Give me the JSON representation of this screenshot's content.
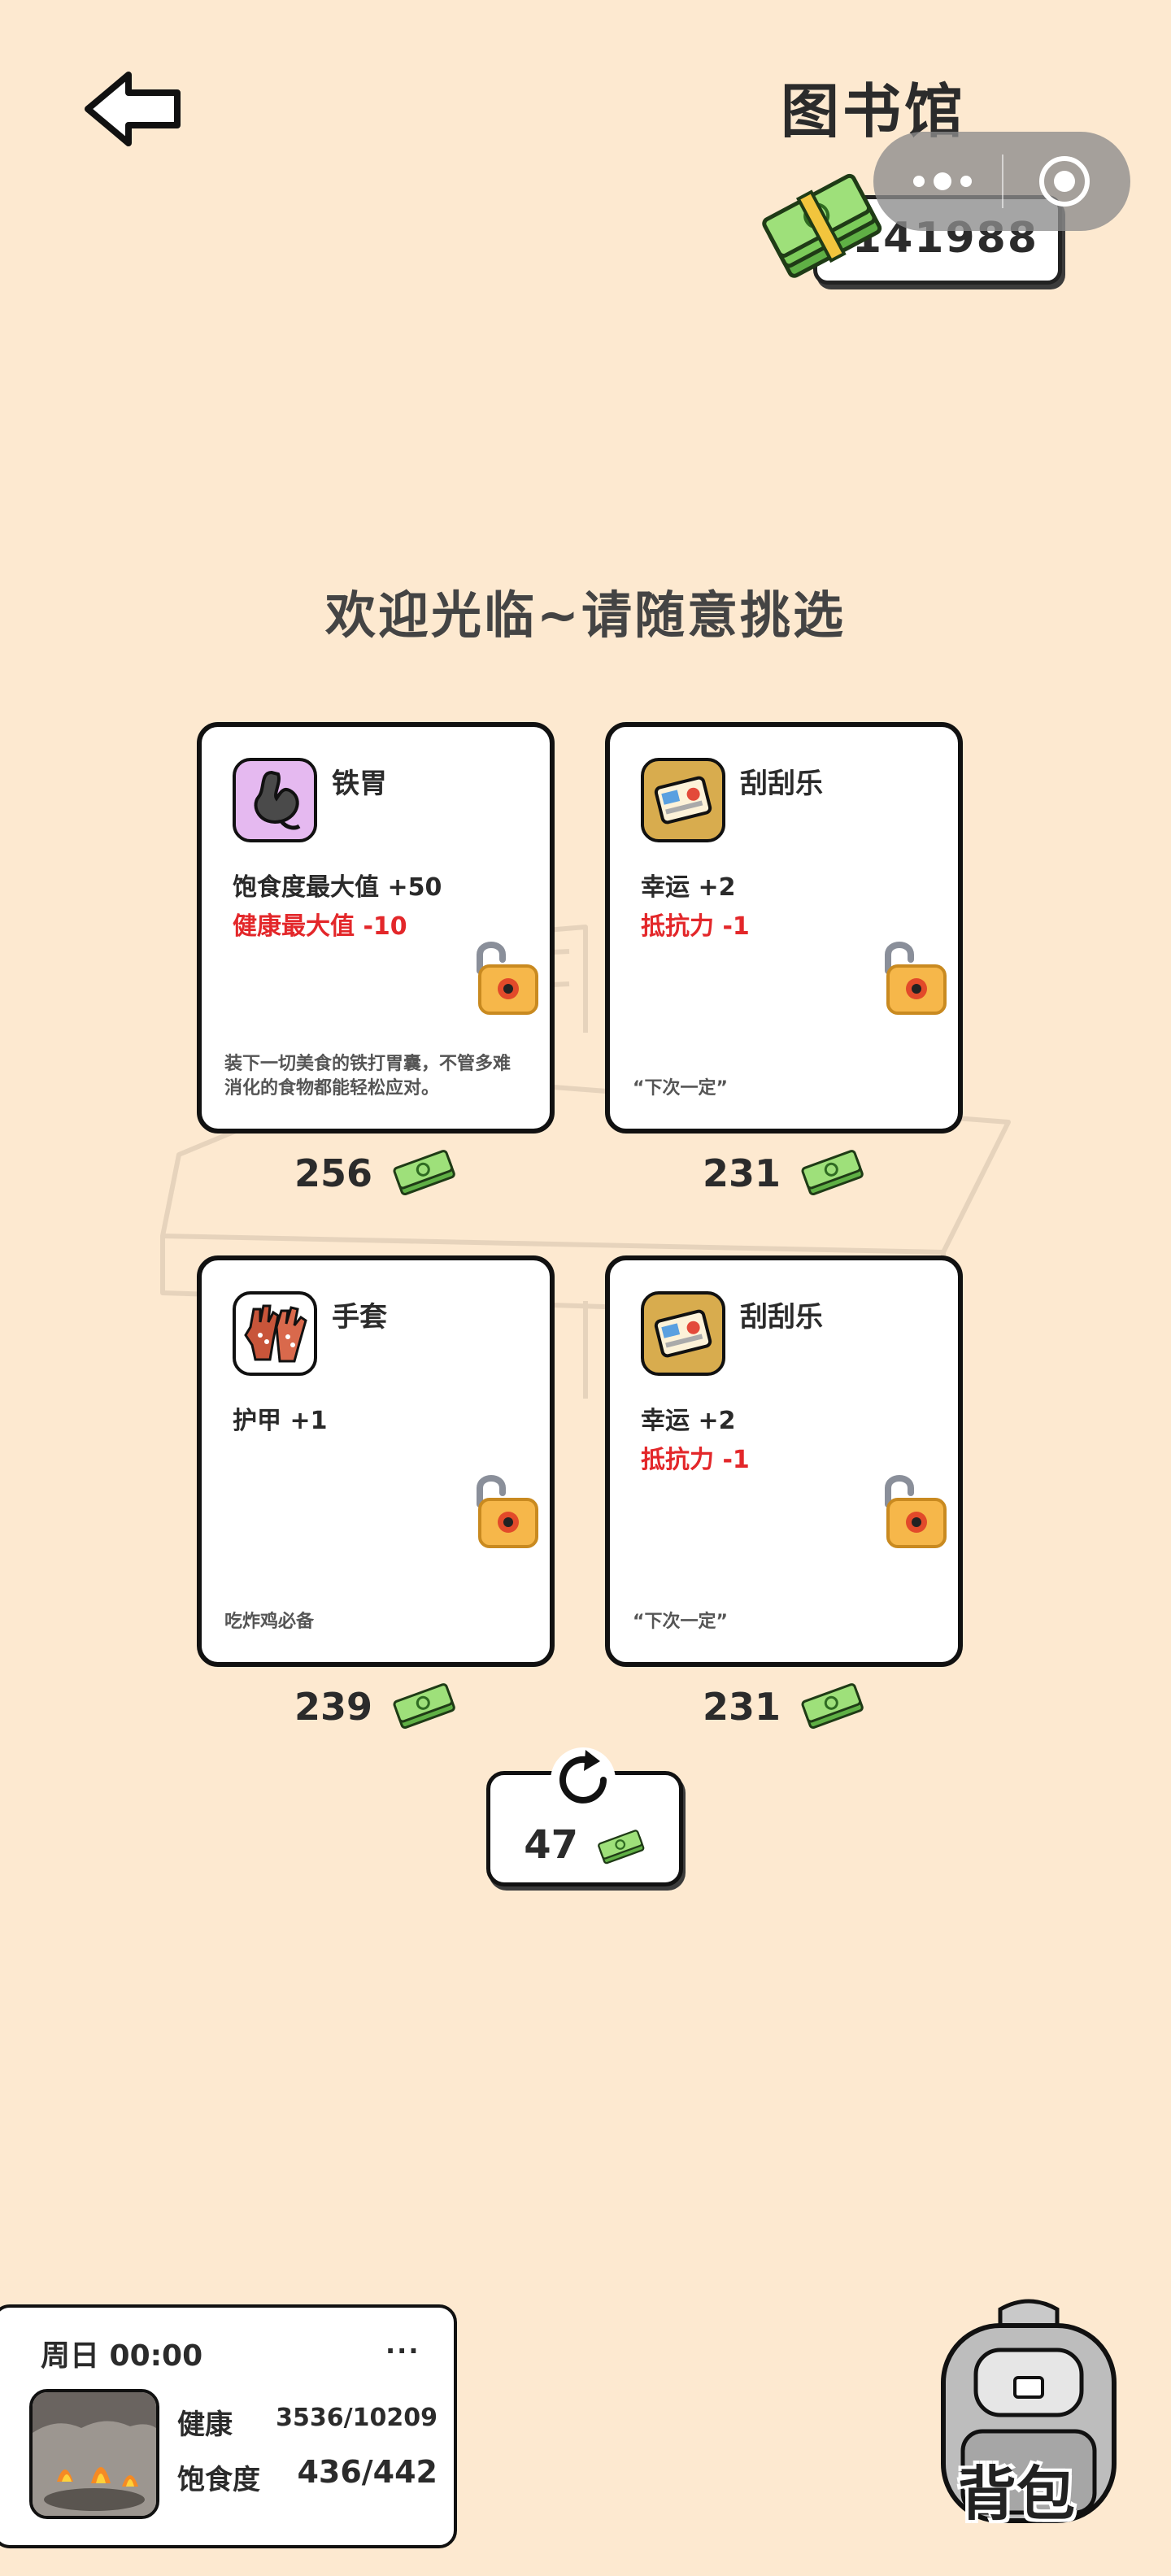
{
  "header": {
    "title": "图书馆",
    "money": "141988",
    "back_icon": "back-arrow-icon",
    "capsule_more_icon": "more-dots-icon",
    "capsule_close_icon": "target-close-icon"
  },
  "welcome": "欢迎光临~请随意挑选",
  "shop": {
    "items": [
      {
        "name": "铁胃",
        "stat1": "饱食度最大值 +50",
        "stat2": "健康最大值 -10",
        "desc": "装下一切美食的铁打胃囊，不管多难消化的食物都能轻松应对。",
        "price": "256",
        "icon": "stomach-icon"
      },
      {
        "name": "刮刮乐",
        "stat1": "幸运 +2",
        "stat2": "抵抗力 -1",
        "desc": "“下次一定”",
        "price": "231",
        "icon": "lottery-ticket-icon"
      },
      {
        "name": "手套",
        "stat1": "护甲 +1",
        "stat2": "",
        "desc": "吃炸鸡必备",
        "price": "239",
        "icon": "gloves-icon"
      },
      {
        "name": "刮刮乐",
        "stat1": "幸运 +2",
        "stat2": "抵抗力 -1",
        "desc": "“下次一定”",
        "price": "231",
        "icon": "lottery-ticket-icon"
      }
    ],
    "refresh_cost": "47"
  },
  "status": {
    "time": "周日 00:00",
    "more": "···",
    "health_label": "健康",
    "health_value": "3536/10209",
    "food_label": "饱食度",
    "food_value": "436/442"
  },
  "backpack_label": "背包",
  "colors": {
    "background": "#fde9d0",
    "negative_stat": "#e3272a",
    "card_border": "#111111"
  }
}
